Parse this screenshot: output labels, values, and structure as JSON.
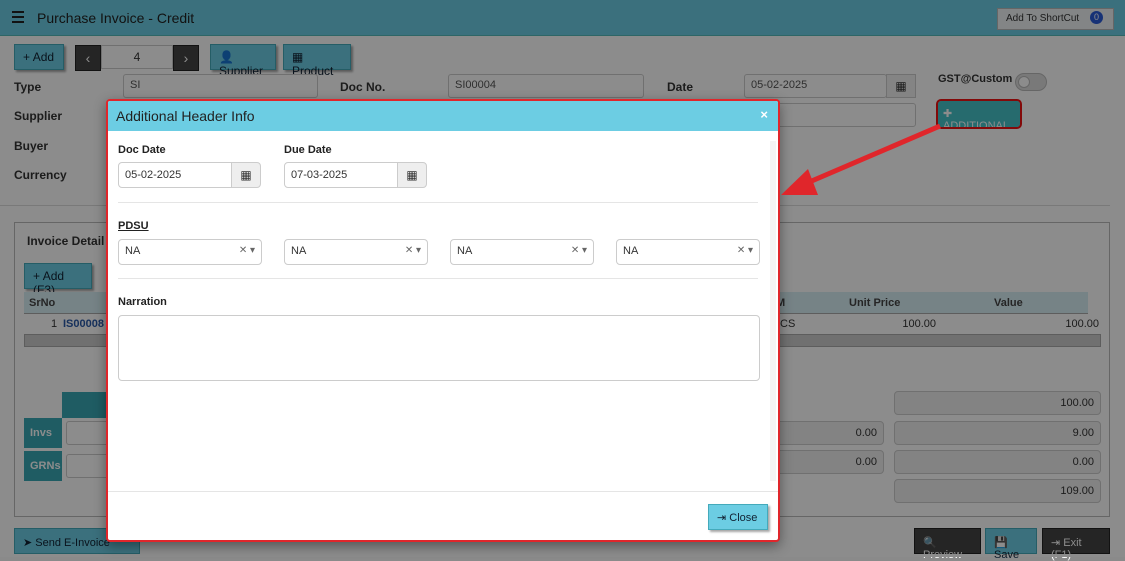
{
  "app": {
    "title": "Purchase Invoice - Credit",
    "shortcut_label": "Add To ShortCut",
    "shortcut_count": "0"
  },
  "toolbar": {
    "add_label": "Add",
    "record_number": "4",
    "supplier_label": "Supplier",
    "product_label": "Product"
  },
  "form": {
    "type_label": "Type",
    "type_value": "SI",
    "docno_label": "Doc No.",
    "docno_value": "SI00004",
    "date_label": "Date",
    "date_value": "05-02-2025",
    "gst_label": "GST@Custom",
    "supplier_label": "Supplier",
    "buyer_label": "Buyer",
    "currency_label": "Currency",
    "additional_label": "ADDITIONAL"
  },
  "invoice": {
    "title": "Invoice Detail",
    "add_label": "Add (F3)",
    "headers": {
      "srno": "SrNo",
      "uom": "M",
      "unit_price": "Unit Price",
      "value": "Value"
    },
    "row": {
      "srno": "1",
      "code": "IS00008",
      "uom": "CS",
      "unit_price": "100.00",
      "value": "100.00"
    }
  },
  "totals": {
    "t1": "100.00",
    "t2": "9.00",
    "t3": "0.00",
    "t4": "109.00",
    "invs_amount": "0.00",
    "grns_amount": "0.00",
    "invs_label": "Invs",
    "grns_label": "GRNs"
  },
  "bottom": {
    "send_label": "Send E-Invoice",
    "preview_label": "Preview",
    "save_label": "Save",
    "exit_label": "Exit (F1)"
  },
  "modal": {
    "title": "Additional Header Info",
    "doc_date_label": "Doc Date",
    "doc_date_value": "05-02-2025",
    "due_date_label": "Due Date",
    "due_date_value": "07-03-2025",
    "pdsu_label": "PDSU",
    "pdsu_values": [
      "NA",
      "NA",
      "NA",
      "NA"
    ],
    "narration_label": "Narration",
    "close_label": "Close"
  },
  "colors": {
    "accent": "#6ccde3",
    "highlight": "#e0262b"
  }
}
